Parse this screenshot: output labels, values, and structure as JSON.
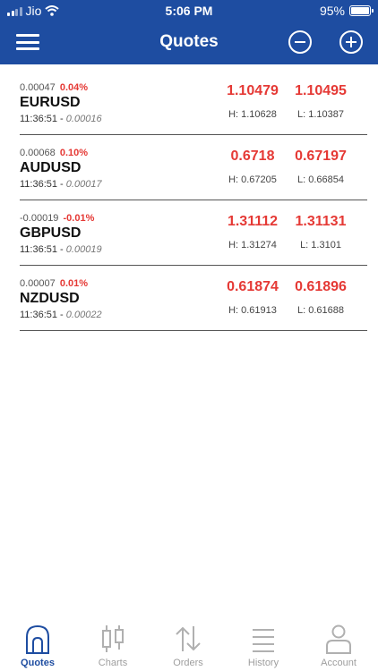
{
  "status_bar": {
    "carrier": "Jio",
    "time": "5:06 PM",
    "battery": "95%"
  },
  "header": {
    "title": "Quotes",
    "menu_icon": "hamburger-icon",
    "zoom_out_icon": "minus-circle-icon",
    "zoom_in_icon": "plus-circle-icon"
  },
  "quotes": [
    {
      "change": "0.00047",
      "change_pct": "0.04%",
      "symbol": "EURUSD",
      "time": "11:36:51 -",
      "spread": "0.00016",
      "bid": "1.10479",
      "ask": "1.10495",
      "high": "H: 1.10628",
      "low": "L: 1.10387"
    },
    {
      "change": "0.00068",
      "change_pct": "0.10%",
      "symbol": "AUDUSD",
      "time": "11:36:51 -",
      "spread": "0.00017",
      "bid": "0.6718",
      "ask": "0.67197",
      "high": "H: 0.67205",
      "low": "L: 0.66854"
    },
    {
      "change": "-0.00019",
      "change_pct": "-0.01%",
      "symbol": "GBPUSD",
      "time": "11:36:51 -",
      "spread": "0.00019",
      "bid": "1.31112",
      "ask": "1.31131",
      "high": "H: 1.31274",
      "low": "L: 1.3101"
    },
    {
      "change": "0.00007",
      "change_pct": "0.01%",
      "symbol": "NZDUSD",
      "time": "11:36:51 -",
      "spread": "0.00022",
      "bid": "0.61874",
      "ask": "0.61896",
      "high": "H: 0.61913",
      "low": "L: 0.61688"
    }
  ],
  "tabs": [
    {
      "label": "Quotes",
      "icon": "home-icon",
      "active": true
    },
    {
      "label": "Charts",
      "icon": "candlestick-icon",
      "active": false
    },
    {
      "label": "Orders",
      "icon": "up-down-arrows-icon",
      "active": false
    },
    {
      "label": "History",
      "icon": "list-lines-icon",
      "active": false
    },
    {
      "label": "Account",
      "icon": "person-icon",
      "active": false
    }
  ],
  "colors": {
    "brand": "#1e4da1",
    "price_down": "#e53935",
    "tab_inactive": "#9e9e9e"
  }
}
